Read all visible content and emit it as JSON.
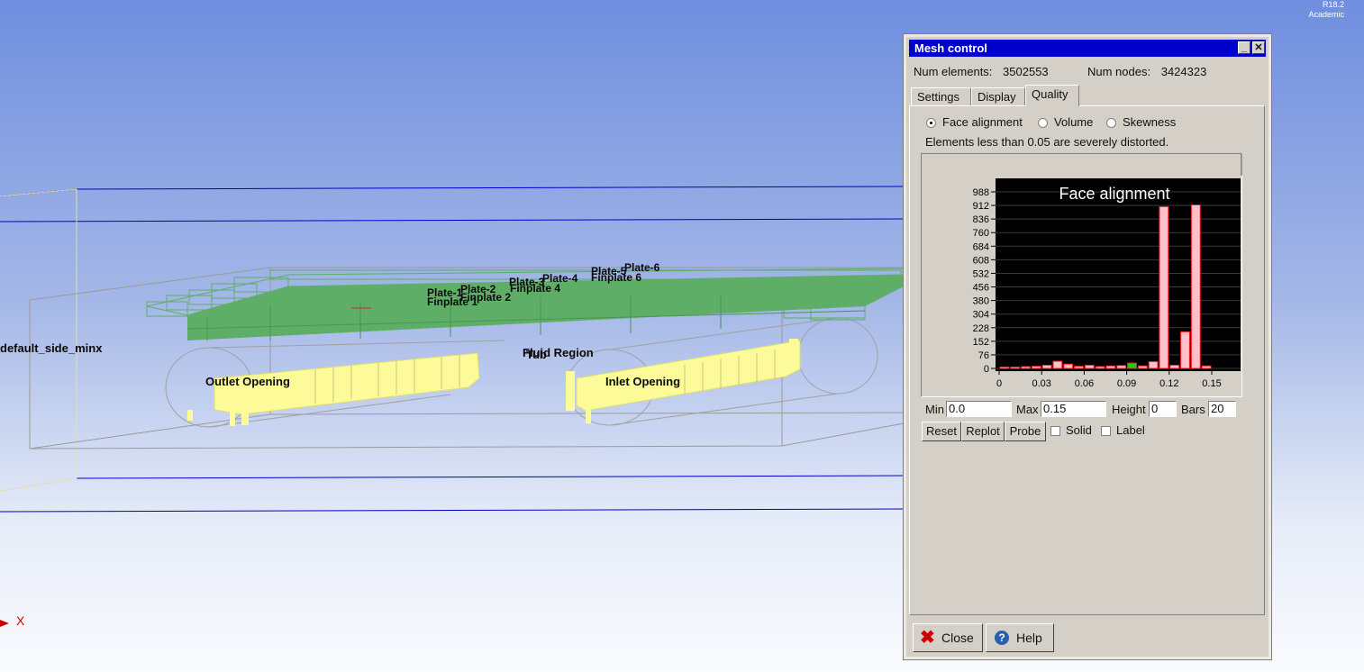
{
  "viewport": {
    "labels": {
      "default_side_minx": "default_side_minx",
      "outlet_opening": "Outlet Opening",
      "inlet_opening": "Inlet Opening",
      "fluid_region": "Fluid Region",
      "plate_1": "Plate-1",
      "plate_2": "Plate-2",
      "plate_3": "Plate-3",
      "plate_4": "Plate-4",
      "plate_5": "Plate-5",
      "plate_6": "Plate-6",
      "finplate_1": "Finplate 1",
      "finplate_2": "Finplate 2",
      "finplate_4": "Finplate 4",
      "finplate_6": "Finplate 6",
      "tub": "Tub"
    },
    "watermark_lines": [
      "R18.2",
      "Academic"
    ],
    "axis_x_label": "X",
    "colors": {
      "background_top": "#6f8edf",
      "mesh_green": "#5fae68",
      "opening_yellow": "#fdfa9a",
      "domain_line_blue": "#0000cc"
    }
  },
  "dialog": {
    "title": "Mesh control",
    "num_elements_label": "Num elements:",
    "num_elements_value": "3502553",
    "num_nodes_label": "Num nodes:",
    "num_nodes_value": "3424323",
    "tabs": [
      "Settings",
      "Display",
      "Quality"
    ],
    "active_tab": "Quality",
    "radio_options": [
      "Face alignment",
      "Volume",
      "Skewness"
    ],
    "radio_selected": "Face alignment",
    "info_text": "Elements less than 0.05 are severely distorted.",
    "fields": {
      "min_label": "Min",
      "min_value": "0.0",
      "max_label": "Max",
      "max_value": "0.15",
      "height_label": "Height",
      "height_value": "0",
      "bars_label": "Bars",
      "bars_value": "20"
    },
    "buttons": {
      "reset": "Reset",
      "replot": "Replot",
      "probe": "Probe",
      "close": "Close",
      "help": "Help"
    },
    "checkboxes": {
      "solid": "Solid",
      "label": "Label"
    },
    "colors": {
      "title_bar": "#0000cc",
      "chart_bg": "#000000",
      "bar_fill": "#ffc0cb",
      "bar_edge": "#ff2020",
      "bar_highlight": "#22cc22"
    }
  },
  "chart_data": {
    "type": "bar",
    "title": "Face alignment",
    "x_ticks": [
      "0",
      "0.03",
      "0.06",
      "0.09",
      "0.12",
      "0.15"
    ],
    "y_ticks": [
      "0",
      "76",
      "152",
      "228",
      "304",
      "380",
      "456",
      "532",
      "608",
      "684",
      "760",
      "836",
      "912",
      "988"
    ],
    "xlim": [
      0,
      0.15
    ],
    "ylim": [
      0,
      988
    ],
    "bin_width": 0.0075,
    "bins": [
      {
        "x": 0.00375,
        "value": 8
      },
      {
        "x": 0.01125,
        "value": 8
      },
      {
        "x": 0.01875,
        "value": 10
      },
      {
        "x": 0.02625,
        "value": 12
      },
      {
        "x": 0.03375,
        "value": 18
      },
      {
        "x": 0.04125,
        "value": 40
      },
      {
        "x": 0.04875,
        "value": 24
      },
      {
        "x": 0.05625,
        "value": 12
      },
      {
        "x": 0.06375,
        "value": 18
      },
      {
        "x": 0.07125,
        "value": 10
      },
      {
        "x": 0.07875,
        "value": 14
      },
      {
        "x": 0.08625,
        "value": 16
      },
      {
        "x": 0.09375,
        "value": 30,
        "highlight": true
      },
      {
        "x": 0.10125,
        "value": 14
      },
      {
        "x": 0.10875,
        "value": 38
      },
      {
        "x": 0.11625,
        "value": 905
      },
      {
        "x": 0.12375,
        "value": 18
      },
      {
        "x": 0.13125,
        "value": 205
      },
      {
        "x": 0.13875,
        "value": 915
      },
      {
        "x": 0.14625,
        "value": 14
      }
    ],
    "grid": true
  }
}
